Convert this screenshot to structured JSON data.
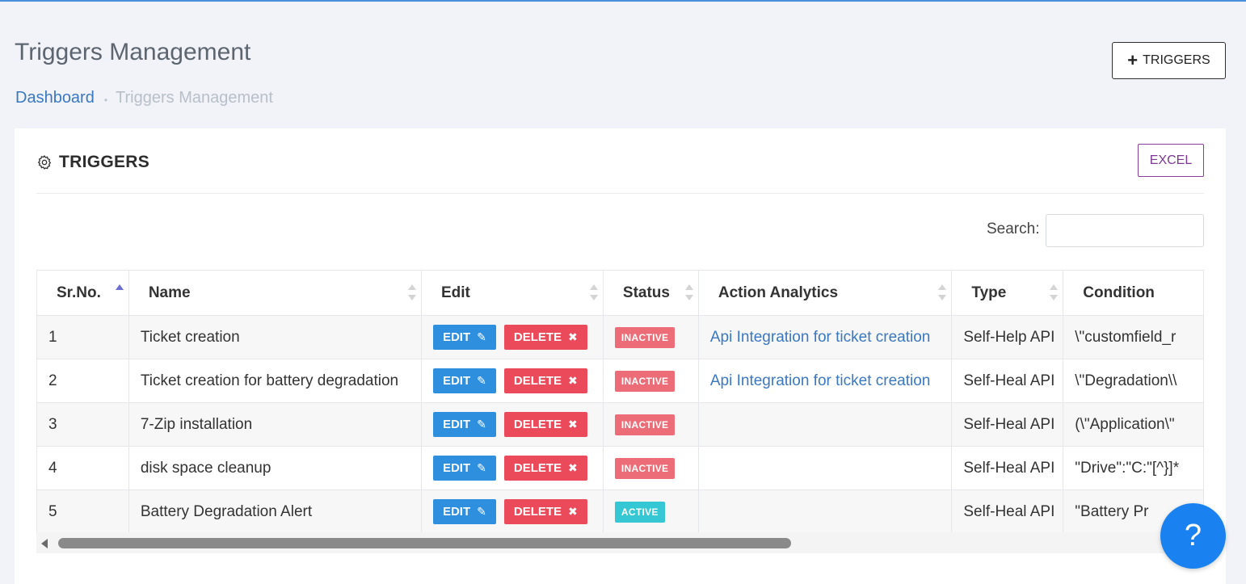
{
  "header": {
    "title": "Triggers Management",
    "add_button_icon": "plus-icon",
    "add_button_label": "TRIGGERS"
  },
  "breadcrumb": {
    "home": "Dashboard",
    "separator": "•",
    "current": "Triggers Management"
  },
  "card": {
    "icon": "gear-icon",
    "title": "TRIGGERS",
    "excel_label": "EXCEL",
    "search_label": "Search:",
    "search_value": ""
  },
  "table": {
    "columns": [
      "Sr.No.",
      "Name",
      "Edit",
      "Status",
      "Action Analytics",
      "Type",
      "Condition"
    ],
    "sorted_column": "Sr.No.",
    "edit_label": "EDIT",
    "delete_label": "DELETE",
    "rows": [
      {
        "sr": "1",
        "name": "Ticket creation",
        "status": "INACTIVE",
        "analytics": "Api Integration for ticket creation",
        "type": "Self-Help API",
        "condition": "\\\"customfield_r"
      },
      {
        "sr": "2",
        "name": "Ticket creation for battery degradation",
        "status": "INACTIVE",
        "analytics": "Api Integration for ticket creation",
        "type": "Self-Heal API",
        "condition": "\\\"Degradation\\\\"
      },
      {
        "sr": "3",
        "name": "7-Zip installation",
        "status": "INACTIVE",
        "analytics": "",
        "type": "Self-Heal API",
        "condition": "(\\\"Application\\\""
      },
      {
        "sr": "4",
        "name": "disk space cleanup",
        "status": "INACTIVE",
        "analytics": "",
        "type": "Self-Heal API",
        "condition": "\"Drive\":\"C:\"[^}]*"
      },
      {
        "sr": "5",
        "name": "Battery Degradation Alert",
        "status": "ACTIVE",
        "analytics": "",
        "type": "Self-Heal API",
        "condition": "\"Battery Pr"
      }
    ]
  },
  "scroll": {
    "horizontal_position": 0
  },
  "help": {
    "label": "?"
  },
  "colors": {
    "edit": "#2f8fdf",
    "delete": "#ea4a5a",
    "inactive": "#ec6d78",
    "active": "#35c7d3",
    "link": "#3b78c2",
    "excel": "#7b3893",
    "help": "#1a82f0"
  }
}
